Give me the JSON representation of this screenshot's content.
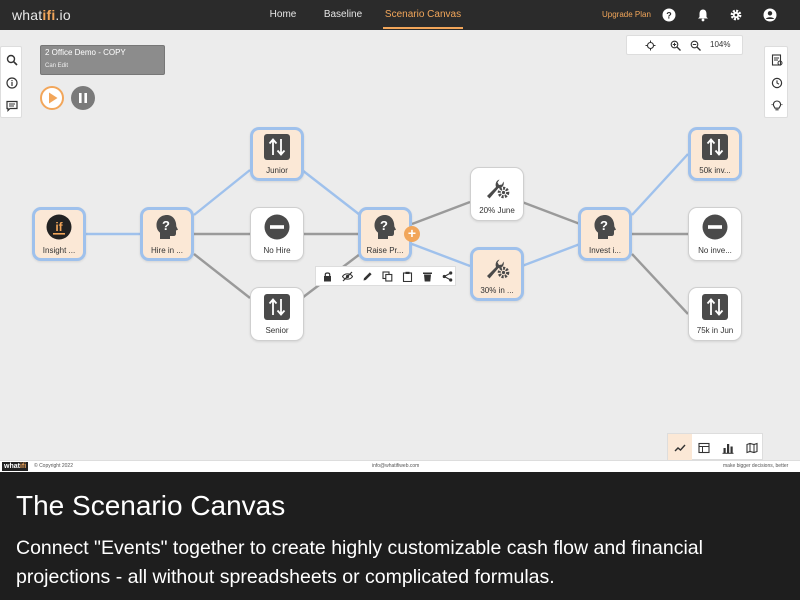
{
  "app": {
    "brand_left": "what",
    "brand_mid": "ifi",
    "brand_right": ".io"
  },
  "nav": {
    "items": [
      "Home",
      "Baseline",
      "Scenario Canvas"
    ],
    "active": "Scenario Canvas",
    "upgrade": "Upgrade Plan"
  },
  "scenario": {
    "name": "2 Office Demo - COPY",
    "permission": "Can Edit"
  },
  "zoom": {
    "level": "104%"
  },
  "nodes": [
    {
      "label": "Insight ...",
      "icon": "if-logo-icon"
    },
    {
      "label": "Hire in ...",
      "icon": "question-head-icon"
    },
    {
      "label": "Junior",
      "icon": "up-down-arrows-icon"
    },
    {
      "label": "No Hire",
      "icon": "minus-circle-icon"
    },
    {
      "label": "Senior",
      "icon": "up-down-arrows-icon"
    },
    {
      "label": "Raise Pr...",
      "icon": "question-head-icon"
    },
    {
      "label": "20% June",
      "icon": "wrench-gear-icon"
    },
    {
      "label": "30% in ...",
      "icon": "wrench-gear-icon"
    },
    {
      "label": "Invest i...",
      "icon": "question-head-icon"
    },
    {
      "label": "50k inv...",
      "icon": "up-down-arrows-icon"
    },
    {
      "label": "No inve...",
      "icon": "minus-circle-icon"
    },
    {
      "label": "75k in Jun",
      "icon": "up-down-arrows-icon"
    }
  ],
  "colors": {
    "accent": "#f2a65a",
    "selected_edge": "#9fc1ec",
    "edge": "#9a9a9a",
    "selected_bg": "#fbe8d6"
  },
  "footer": {
    "logo_left": "what",
    "logo_mid": "ifi",
    "copyright": "© Copyright 2022",
    "email": "info@whatifiweb.com",
    "tagline": "make bigger decisions, better"
  },
  "caption": {
    "title": "The Scenario Canvas",
    "text": "Connect \"Events\" together to create highly customizable cash flow and financial projections - all without spreadsheets or complicated formulas."
  }
}
